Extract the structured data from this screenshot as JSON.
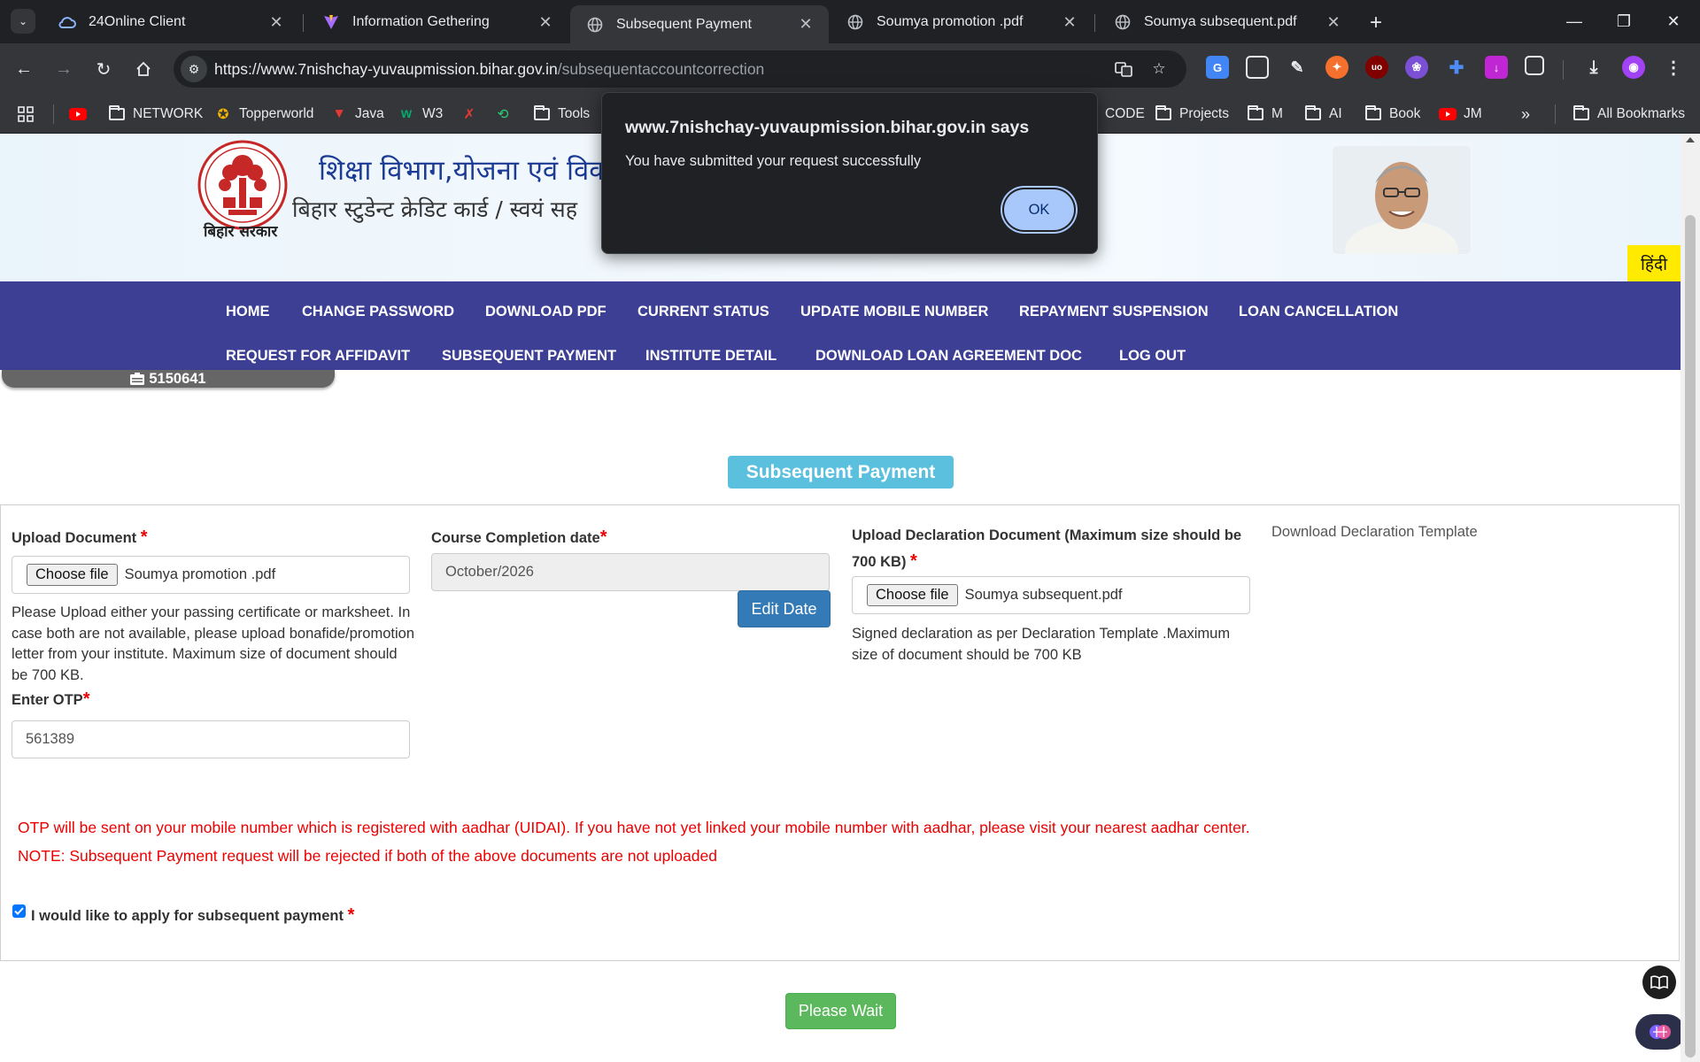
{
  "browser": {
    "tabs": [
      {
        "title": "24Online Client",
        "active": false
      },
      {
        "title": "Information Gethering",
        "active": false
      },
      {
        "title": "Subsequent Payment",
        "active": true
      },
      {
        "title": "Soumya promotion .pdf",
        "active": false
      },
      {
        "title": "Soumya subsequent.pdf",
        "active": false
      }
    ],
    "url_host": "https://www.7nishchay-yuvaupmission.bihar.gov.in",
    "url_path": "/subsequentaccountcorrection",
    "bookmarks": [
      "NETWORK",
      "Topperworld",
      "Java",
      "W3",
      "Tools",
      "CODE",
      "Projects",
      "M",
      "AI",
      "Book",
      "JM"
    ],
    "all_bookmarks": "All Bookmarks"
  },
  "header": {
    "emblem_caption": "बिहार सरकार",
    "line1": "शिक्षा विभाग,योजना एवं विक",
    "line2": "बिहार स्टुडेन्ट क्रेडिट कार्ड / स्वयं सह",
    "language_button": "हिंदी"
  },
  "nav": {
    "row1": [
      "HOME",
      "CHANGE PASSWORD",
      "DOWNLOAD PDF",
      "CURRENT STATUS",
      "UPDATE MOBILE NUMBER",
      "REPAYMENT SUSPENSION",
      "LOAN CANCELLATION"
    ],
    "row2": [
      "REQUEST FOR AFFIDAVIT",
      "SUBSEQUENT PAYMENT",
      "INSTITUTE DETAIL",
      "DOWNLOAD LOAN AGREEMENT DOC",
      "LOG OUT"
    ]
  },
  "user": {
    "id": "5150641"
  },
  "form": {
    "title": "Subsequent Payment",
    "upload_document": {
      "label": "Upload Document",
      "button": "Choose file",
      "file_name": "Soumya promotion .pdf",
      "help_lines": [
        "Please Upload either your passing certificate or marksheet. In",
        "case both are not available, please upload bonafide/promotion",
        "letter from your institute. Maximum size of document should",
        "be 700 KB."
      ]
    },
    "completion_date": {
      "label": "Course Completion date",
      "value": "October/2026",
      "edit_button": "Edit Date"
    },
    "declaration": {
      "label_line1": "Upload Declaration Document (Maximum size should be",
      "label_line2": "700 KB)",
      "button": "Choose file",
      "file_name": "Soumya subsequent.pdf",
      "help_lines": [
        "Signed declaration as per Declaration Template .Maximum",
        "size of document should be 700 KB"
      ]
    },
    "download_template": "Download Declaration Template",
    "otp": {
      "label": "Enter OTP",
      "value": "561389"
    },
    "otp_notice": "OTP will be sent on your mobile number which is registered with aadhar (UIDAI). If you have not yet linked your mobile number with aadhar, please visit your nearest aadhar center.",
    "note": "NOTE: Subsequent Payment request will be rejected if both of the above documents are not uploaded",
    "checkbox_label": "I would like to apply for subsequent payment",
    "checkbox_checked": true,
    "submit_button": "Please Wait",
    "required_mark": "*"
  },
  "dialog": {
    "title": "www.7nishchay-yuvaupmission.bihar.gov.in says",
    "message": "You have submitted your request successfully",
    "ok_button": "OK"
  },
  "colors": {
    "nav_bg": "#3d3f94",
    "title_badge": "#5bc0de",
    "edit_button": "#337ab7",
    "submit_button": "#5cb85c",
    "notice_text": "#ee0000",
    "hindi_button": "#ffea00"
  }
}
